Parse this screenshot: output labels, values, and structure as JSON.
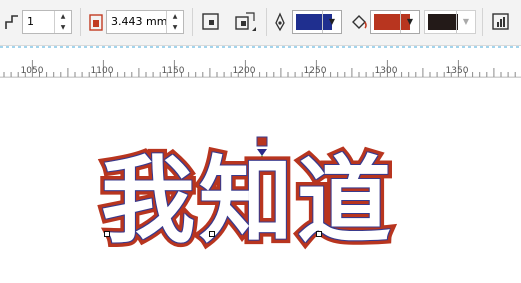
{
  "toolbar": {
    "outline_width_value": "1",
    "size_value": "3.443 mm",
    "outline_color": "#1f2f8f",
    "fill_color": "#b8351f",
    "extra_color": "#231a18"
  },
  "ruler": {
    "labels": [
      "1050",
      "1100",
      "1150",
      "1200",
      "1250",
      "1300",
      "1350"
    ]
  },
  "canvas": {
    "art_text": "我知道",
    "outline_color": "#b8351f",
    "fill_color": "#ffffff",
    "edge_color": "#3a3a8c"
  }
}
